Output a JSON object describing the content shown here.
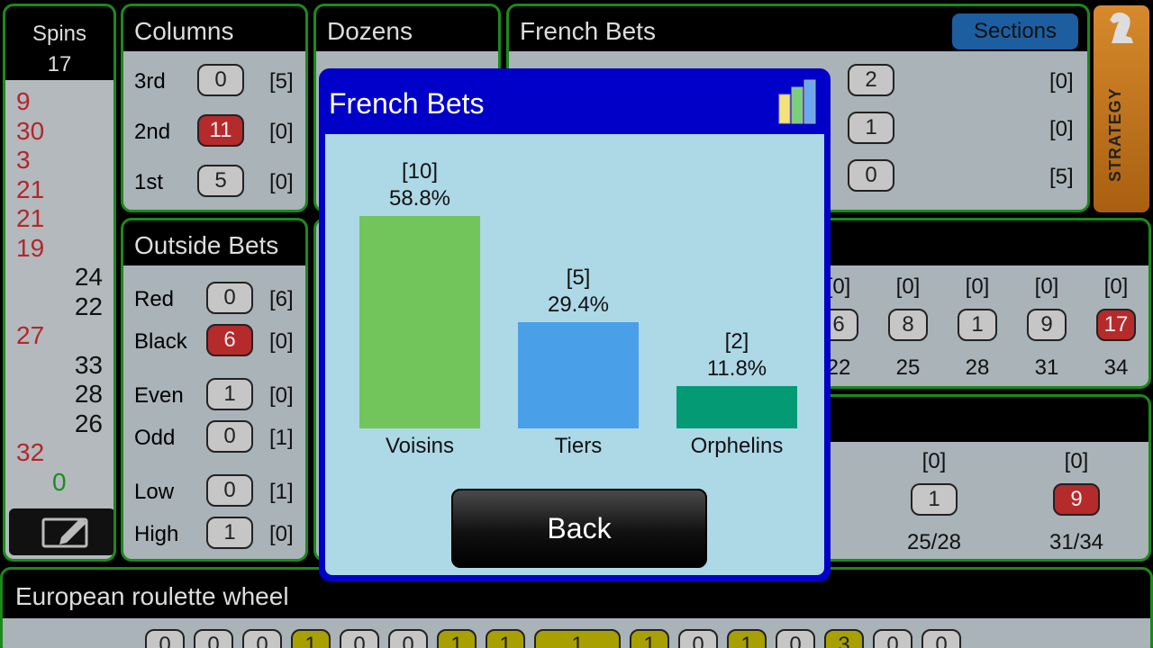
{
  "spins": {
    "title": "Spins",
    "count": "17",
    "list": [
      {
        "n": "9",
        "c": "r"
      },
      {
        "n": "30",
        "c": "r"
      },
      {
        "n": "3",
        "c": "r"
      },
      {
        "n": "21",
        "c": "r"
      },
      {
        "n": "21",
        "c": "r"
      },
      {
        "n": "19",
        "c": "r"
      },
      {
        "n": "24",
        "c": "b"
      },
      {
        "n": "22",
        "c": "b"
      },
      {
        "n": "27",
        "c": "r"
      },
      {
        "n": "33",
        "c": "b"
      },
      {
        "n": "28",
        "c": "b"
      },
      {
        "n": "26",
        "c": "b"
      },
      {
        "n": "32",
        "c": "r"
      },
      {
        "n": "0",
        "c": "g"
      }
    ]
  },
  "columns": {
    "title": "Columns",
    "rows": [
      {
        "label": "3rd",
        "count": "0",
        "bracket": "[5]"
      },
      {
        "label": "2nd",
        "count": "11",
        "bracket": "[0]"
      },
      {
        "label": "1st",
        "count": "5",
        "bracket": "[0]"
      }
    ]
  },
  "dozens": {
    "title": "Dozens"
  },
  "french_panel": {
    "title": "French Bets",
    "sections_label": "Sections",
    "rows": [
      {
        "count": "2",
        "bracket": "[0]"
      },
      {
        "count": "1",
        "bracket": "[0]"
      },
      {
        "count": "0",
        "bracket": "[5]"
      }
    ]
  },
  "strategy_label": "STRATEGY",
  "outside": {
    "title": "Outside Bets",
    "rows": [
      {
        "label": "Red",
        "count": "0",
        "bracket": "[6]"
      },
      {
        "label": "Black",
        "count": "6",
        "bracket": "[0]"
      },
      {
        "label": "Even",
        "count": "1",
        "bracket": "[0]"
      },
      {
        "label": "Odd",
        "count": "0",
        "bracket": "[1]"
      },
      {
        "label": "Low",
        "count": "0",
        "bracket": "[1]"
      },
      {
        "label": "High",
        "count": "1",
        "bracket": "[0]"
      }
    ]
  },
  "streets": {
    "cols": [
      {
        "bracket": "[0]",
        "count": "6",
        "num": "22"
      },
      {
        "bracket": "[0]",
        "count": "8",
        "num": "25"
      },
      {
        "bracket": "[0]",
        "count": "1",
        "num": "28"
      },
      {
        "bracket": "[0]",
        "count": "9",
        "num": "31"
      },
      {
        "bracket": "[0]",
        "count": "17",
        "num": "34"
      }
    ]
  },
  "splits": {
    "cols": [
      {
        "bracket": "[0]",
        "count": "1",
        "num": "25/28"
      },
      {
        "bracket": "[0]",
        "count": "9",
        "num": "31/34"
      }
    ]
  },
  "wheel": {
    "title": "European roulette wheel",
    "values": [
      "0",
      "0",
      "0",
      "1",
      "0",
      "0",
      "1",
      "1",
      "1",
      "1",
      "0",
      "1",
      "0",
      "3",
      "0",
      "0"
    ]
  },
  "dialog": {
    "title": "French Bets",
    "back_label": "Back"
  },
  "colors": {
    "voisins": "#72c55a",
    "tiers": "#499fe8",
    "orphelins": "#039a74"
  },
  "chart_data": {
    "type": "bar",
    "categories": [
      "Voisins",
      "Tiers",
      "Orphelins"
    ],
    "values": [
      58.8,
      29.4,
      11.8
    ],
    "labels": [
      "58.8%",
      "29.4%",
      "11.8%"
    ],
    "counts": [
      "[10]",
      "[5]",
      "[2]"
    ],
    "ylim": [
      0,
      100
    ]
  }
}
